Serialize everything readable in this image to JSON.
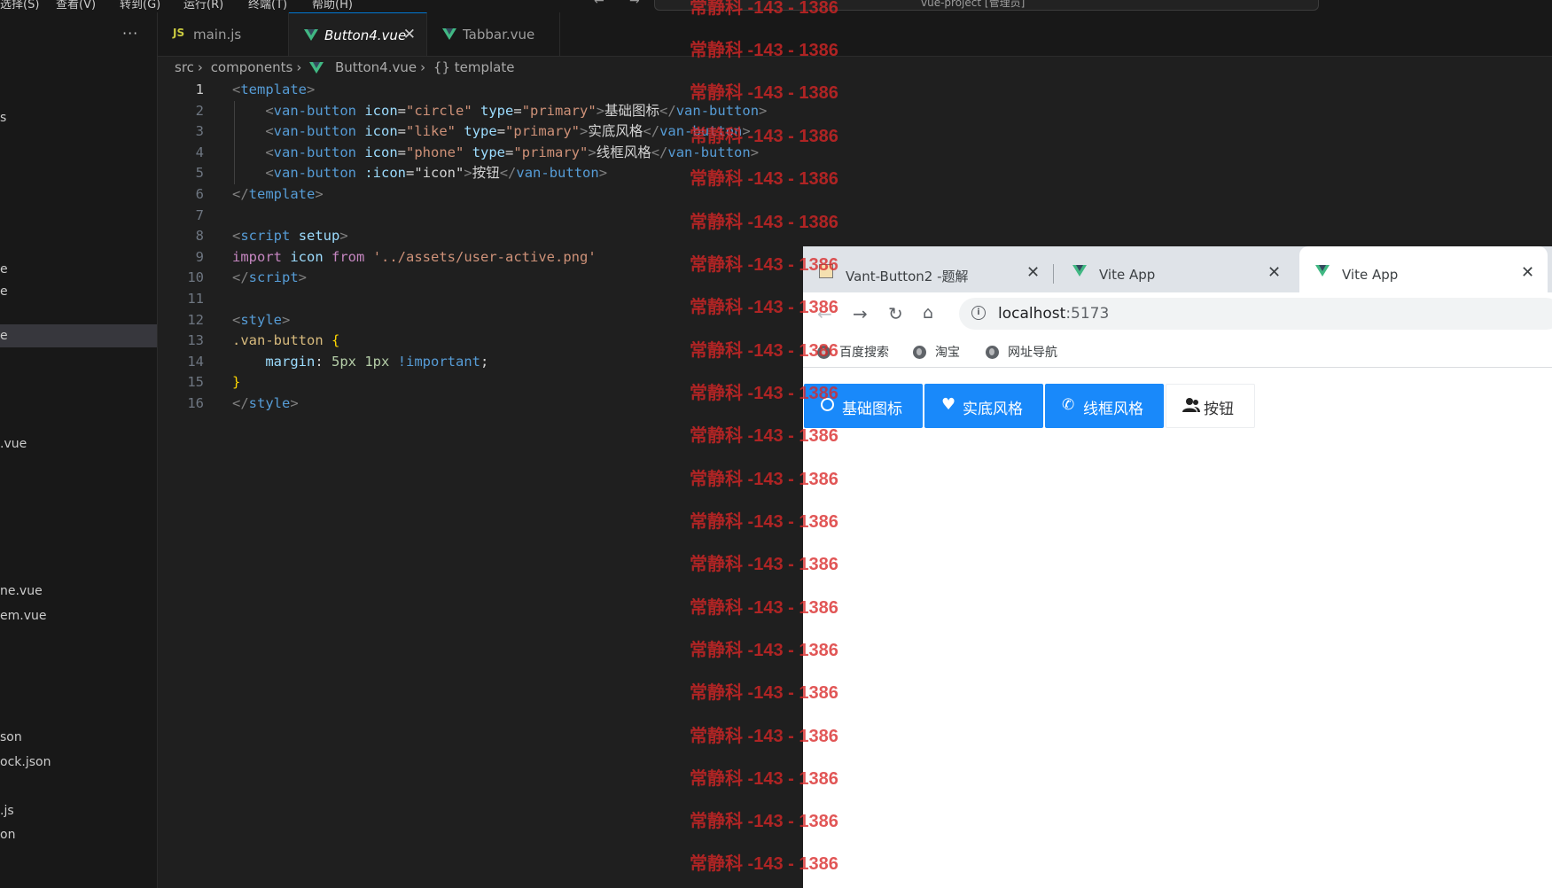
{
  "menubar": {
    "items": [
      "选择(S)",
      "查看(V)",
      "转到(G)",
      "运行(R)",
      "终端(T)",
      "帮助(H)"
    ],
    "search_text": "vue-project [管理员]"
  },
  "explorer": {
    "more_icon": "ellipsis-icon",
    "items": [
      {
        "label": "s",
        "selected": false
      },
      {
        "label": "e",
        "selected": false
      },
      {
        "label": "e",
        "selected": false
      },
      {
        "label": "e",
        "selected": true
      },
      {
        "label": ".vue",
        "selected": false
      },
      {
        "label": "ne.vue",
        "selected": false
      },
      {
        "label": "em.vue",
        "selected": false
      },
      {
        "label": "son",
        "selected": false
      },
      {
        "label": "ock.json",
        "selected": false
      },
      {
        "label": ".js",
        "selected": false
      },
      {
        "label": "on",
        "selected": false
      }
    ]
  },
  "editor": {
    "tabs": [
      {
        "label": "main.js",
        "icon": "js-icon",
        "icon_text": "JS",
        "active": false
      },
      {
        "label": "Button4.vue",
        "icon": "vue-icon",
        "active": true
      },
      {
        "label": "Tabbar.vue",
        "icon": "vue-icon",
        "active": false
      }
    ],
    "close_glyph": "✕",
    "breadcrumb": [
      "src",
      "components",
      "Button4.vue",
      "{} template"
    ],
    "line_numbers": [
      "1",
      "2",
      "3",
      "4",
      "5",
      "6",
      "7",
      "8",
      "9",
      "10",
      "11",
      "12",
      "13",
      "14",
      "15",
      "16"
    ]
  },
  "browser": {
    "tabs": [
      {
        "label": "Vant-Button2 -题解",
        "active": false
      },
      {
        "label": "Vite App",
        "active": false
      },
      {
        "label": "Vite App",
        "active": true
      }
    ],
    "url_host": "localhost",
    "url_port": ":5173",
    "bookmarks": [
      "百度搜索",
      "淘宝",
      "网址导航"
    ],
    "buttons": [
      {
        "label": "基础图标",
        "type": "primary",
        "icon": "circle-icon"
      },
      {
        "label": "实底风格",
        "type": "primary",
        "icon": "heart-icon"
      },
      {
        "label": "线框风格",
        "type": "primary",
        "icon": "phone-icon"
      },
      {
        "label": "按钮",
        "type": "default",
        "icon": "user-icon"
      }
    ]
  },
  "watermark": "常静科 -143 - 1386",
  "colors": {
    "editor_bg": "#1f1f1f",
    "sidebar_bg": "#181818",
    "vant_primary": "#1989fa",
    "watermark": "#d82626"
  }
}
